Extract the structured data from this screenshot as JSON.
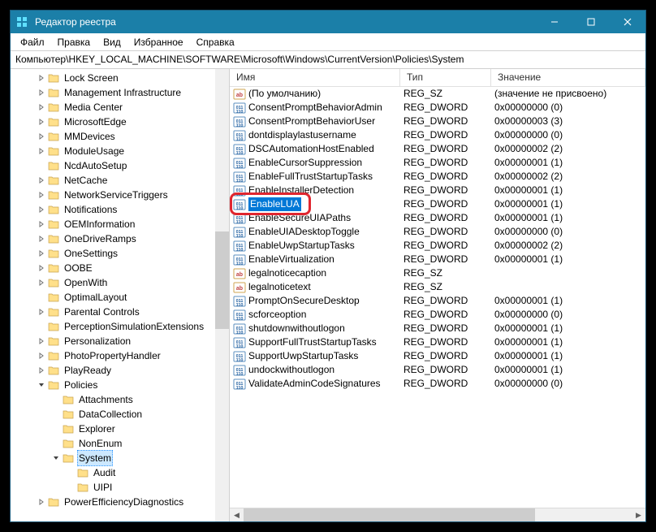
{
  "title": "Редактор реестра",
  "menu": {
    "file": "Файл",
    "edit": "Правка",
    "view": "Вид",
    "favorites": "Избранное",
    "help": "Справка"
  },
  "address": "Компьютер\\HKEY_LOCAL_MACHINE\\SOFTWARE\\Microsoft\\Windows\\CurrentVersion\\Policies\\System",
  "columns": {
    "name": "Имя",
    "type": "Тип",
    "value": "Значение"
  },
  "tree": [
    {
      "depth": 0,
      "expand": "right",
      "label": "Lock Screen"
    },
    {
      "depth": 0,
      "expand": "right",
      "label": "Management Infrastructure"
    },
    {
      "depth": 0,
      "expand": "right",
      "label": "Media Center"
    },
    {
      "depth": 0,
      "expand": "right",
      "label": "MicrosoftEdge"
    },
    {
      "depth": 0,
      "expand": "right",
      "label": "MMDevices"
    },
    {
      "depth": 0,
      "expand": "right",
      "label": "ModuleUsage"
    },
    {
      "depth": 0,
      "expand": "",
      "label": "NcdAutoSetup"
    },
    {
      "depth": 0,
      "expand": "right",
      "label": "NetCache"
    },
    {
      "depth": 0,
      "expand": "right",
      "label": "NetworkServiceTriggers"
    },
    {
      "depth": 0,
      "expand": "right",
      "label": "Notifications"
    },
    {
      "depth": 0,
      "expand": "right",
      "label": "OEMInformation"
    },
    {
      "depth": 0,
      "expand": "right",
      "label": "OneDriveRamps"
    },
    {
      "depth": 0,
      "expand": "right",
      "label": "OneSettings"
    },
    {
      "depth": 0,
      "expand": "right",
      "label": "OOBE"
    },
    {
      "depth": 0,
      "expand": "right",
      "label": "OpenWith"
    },
    {
      "depth": 0,
      "expand": "",
      "label": "OptimalLayout"
    },
    {
      "depth": 0,
      "expand": "right",
      "label": "Parental Controls"
    },
    {
      "depth": 0,
      "expand": "",
      "label": "PerceptionSimulationExtensions"
    },
    {
      "depth": 0,
      "expand": "right",
      "label": "Personalization"
    },
    {
      "depth": 0,
      "expand": "right",
      "label": "PhotoPropertyHandler"
    },
    {
      "depth": 0,
      "expand": "right",
      "label": "PlayReady"
    },
    {
      "depth": 0,
      "expand": "down",
      "label": "Policies"
    },
    {
      "depth": 1,
      "expand": "",
      "label": "Attachments"
    },
    {
      "depth": 1,
      "expand": "",
      "label": "DataCollection"
    },
    {
      "depth": 1,
      "expand": "",
      "label": "Explorer"
    },
    {
      "depth": 1,
      "expand": "",
      "label": "NonEnum"
    },
    {
      "depth": 1,
      "expand": "down",
      "label": "System",
      "selected": true
    },
    {
      "depth": 2,
      "expand": "",
      "label": "Audit"
    },
    {
      "depth": 2,
      "expand": "",
      "label": "UIPI"
    },
    {
      "depth": 0,
      "expand": "right",
      "label": "PowerEfficiencyDiagnostics"
    }
  ],
  "values": [
    {
      "icon": "str",
      "name": "(По умолчанию)",
      "type": "REG_SZ",
      "value": "(значение не присвоено)"
    },
    {
      "icon": "bin",
      "name": "ConsentPromptBehaviorAdmin",
      "type": "REG_DWORD",
      "value": "0x00000000 (0)"
    },
    {
      "icon": "bin",
      "name": "ConsentPromptBehaviorUser",
      "type": "REG_DWORD",
      "value": "0x00000003 (3)"
    },
    {
      "icon": "bin",
      "name": "dontdisplaylastusername",
      "type": "REG_DWORD",
      "value": "0x00000000 (0)"
    },
    {
      "icon": "bin",
      "name": "DSCAutomationHostEnabled",
      "type": "REG_DWORD",
      "value": "0x00000002 (2)"
    },
    {
      "icon": "bin",
      "name": "EnableCursorSuppression",
      "type": "REG_DWORD",
      "value": "0x00000001 (1)"
    },
    {
      "icon": "bin",
      "name": "EnableFullTrustStartupTasks",
      "type": "REG_DWORD",
      "value": "0x00000002 (2)"
    },
    {
      "icon": "bin",
      "name": "EnableInstallerDetection",
      "type": "REG_DWORD",
      "value": "0x00000001 (1)"
    },
    {
      "icon": "bin",
      "name": "EnableLUA",
      "type": "REG_DWORD",
      "value": "0x00000001 (1)",
      "selected": true,
      "highlight": true
    },
    {
      "icon": "bin",
      "name": "EnableSecureUIAPaths",
      "type": "REG_DWORD",
      "value": "0x00000001 (1)"
    },
    {
      "icon": "bin",
      "name": "EnableUIADesktopToggle",
      "type": "REG_DWORD",
      "value": "0x00000000 (0)"
    },
    {
      "icon": "bin",
      "name": "EnableUwpStartupTasks",
      "type": "REG_DWORD",
      "value": "0x00000002 (2)"
    },
    {
      "icon": "bin",
      "name": "EnableVirtualization",
      "type": "REG_DWORD",
      "value": "0x00000001 (1)"
    },
    {
      "icon": "str",
      "name": "legalnoticecaption",
      "type": "REG_SZ",
      "value": ""
    },
    {
      "icon": "str",
      "name": "legalnoticetext",
      "type": "REG_SZ",
      "value": ""
    },
    {
      "icon": "bin",
      "name": "PromptOnSecureDesktop",
      "type": "REG_DWORD",
      "value": "0x00000001 (1)"
    },
    {
      "icon": "bin",
      "name": "scforceoption",
      "type": "REG_DWORD",
      "value": "0x00000000 (0)"
    },
    {
      "icon": "bin",
      "name": "shutdownwithoutlogon",
      "type": "REG_DWORD",
      "value": "0x00000001 (1)"
    },
    {
      "icon": "bin",
      "name": "SupportFullTrustStartupTasks",
      "type": "REG_DWORD",
      "value": "0x00000001 (1)"
    },
    {
      "icon": "bin",
      "name": "SupportUwpStartupTasks",
      "type": "REG_DWORD",
      "value": "0x00000001 (1)"
    },
    {
      "icon": "bin",
      "name": "undockwithoutlogon",
      "type": "REG_DWORD",
      "value": "0x00000001 (1)"
    },
    {
      "icon": "bin",
      "name": "ValidateAdminCodeSignatures",
      "type": "REG_DWORD",
      "value": "0x00000000 (0)"
    }
  ]
}
